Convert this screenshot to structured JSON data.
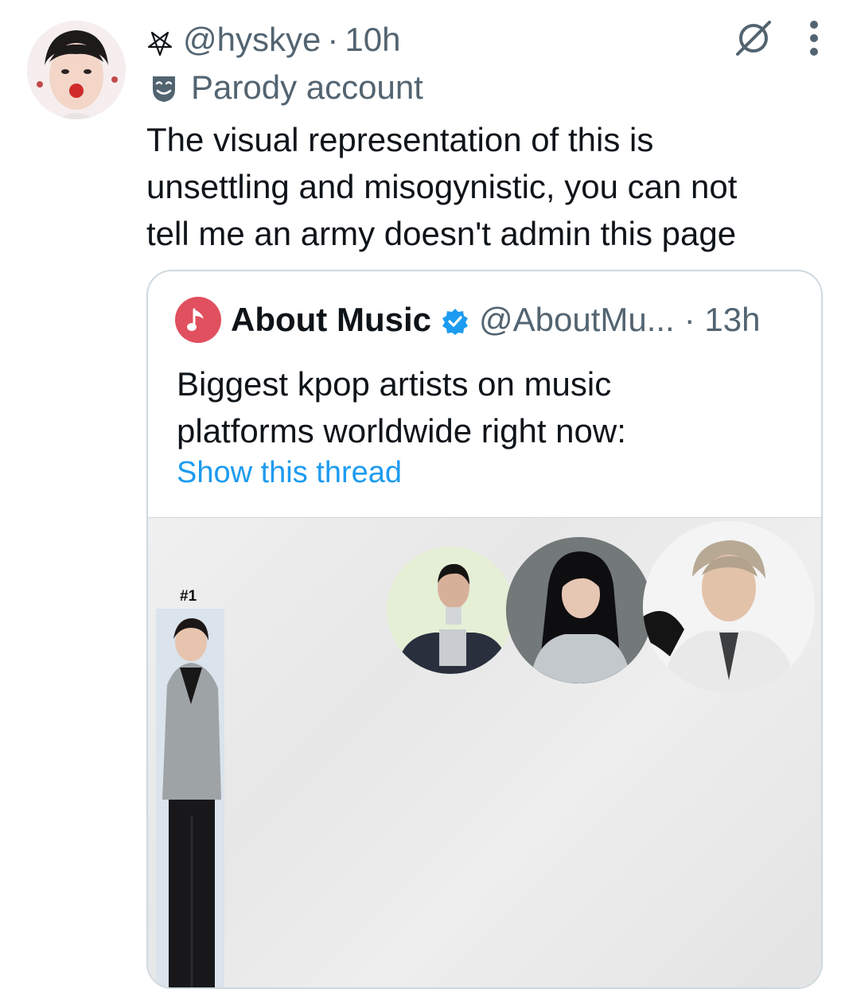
{
  "tweet": {
    "handle": "@hyskye",
    "separator": "·",
    "time": "10h",
    "parody_label": "Parody account",
    "text": "The visual representation of this is\nunsettling and misogynistic, you can not\ntell me an army doesn't  admin this page"
  },
  "quote": {
    "name": "About Music",
    "handle": "@AboutMu...",
    "time": "· 13h",
    "text": "Biggest kpop artists on music\nplatforms worldwide right now:",
    "show_thread": "Show this thread",
    "media": {
      "rank_label": "#1"
    }
  },
  "colors": {
    "secondary_text": "#536471",
    "link": "#1d9bf0",
    "verified": "#1d9bf0",
    "border": "#cfd9de"
  },
  "icons": [
    "pentagram-icon",
    "parody-mask-icon",
    "grok-icon",
    "more-options-icon",
    "verified-badge-icon",
    "music-note-icon"
  ]
}
